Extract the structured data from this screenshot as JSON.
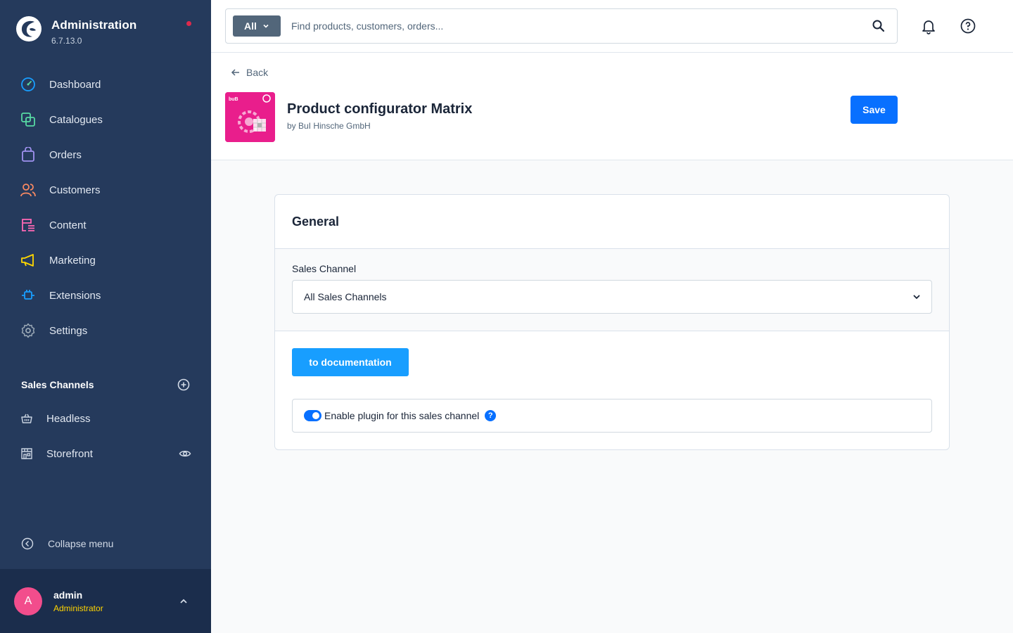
{
  "app": {
    "title": "Administration",
    "version": "6.7.13.0"
  },
  "sidebar": {
    "items": [
      {
        "label": "Dashboard",
        "icon": "dashboard-icon",
        "color": "#57d9a3"
      },
      {
        "label": "Catalogues",
        "icon": "catalogues-icon",
        "color": "#57d9a3"
      },
      {
        "label": "Orders",
        "icon": "orders-icon",
        "color": "#a092f0"
      },
      {
        "label": "Customers",
        "icon": "customers-icon",
        "color": "#f88962"
      },
      {
        "label": "Content",
        "icon": "content-icon",
        "color": "#ff68b4"
      },
      {
        "label": "Marketing",
        "icon": "marketing-icon",
        "color": "#ffd700"
      },
      {
        "label": "Extensions",
        "icon": "extensions-icon",
        "color": "#189eff"
      },
      {
        "label": "Settings",
        "icon": "settings-icon",
        "color": "#9aa8b5"
      }
    ],
    "sales_channels": {
      "title": "Sales Channels",
      "items": [
        {
          "label": "Headless",
          "icon": "basket-icon"
        },
        {
          "label": "Storefront",
          "icon": "storefront-icon"
        }
      ]
    },
    "collapse_label": "Collapse menu",
    "user": {
      "initial": "A",
      "name": "admin",
      "role": "Administrator"
    }
  },
  "search": {
    "type_label": "All",
    "placeholder": "Find products, customers, orders..."
  },
  "page": {
    "back_label": "Back",
    "title": "Product configurator Matrix",
    "vendor": "by BuI Hinsche GmbH",
    "save_label": "Save",
    "plugin_icon_text": "buB"
  },
  "card": {
    "title": "General",
    "sales_channel_label": "Sales Channel",
    "sales_channel_value": "All Sales Channels",
    "doc_button_label": "to documentation",
    "toggle_label": "Enable plugin for this sales channel",
    "toggle_enabled": true,
    "help_glyph": "?"
  },
  "colors": {
    "sidebar_bg": "#253a5c",
    "primary": "#0870ff",
    "doc_button": "#189eff",
    "plugin_brand": "#e91e8c",
    "notification_dot": "#de294c",
    "role_color": "#ffd400"
  }
}
